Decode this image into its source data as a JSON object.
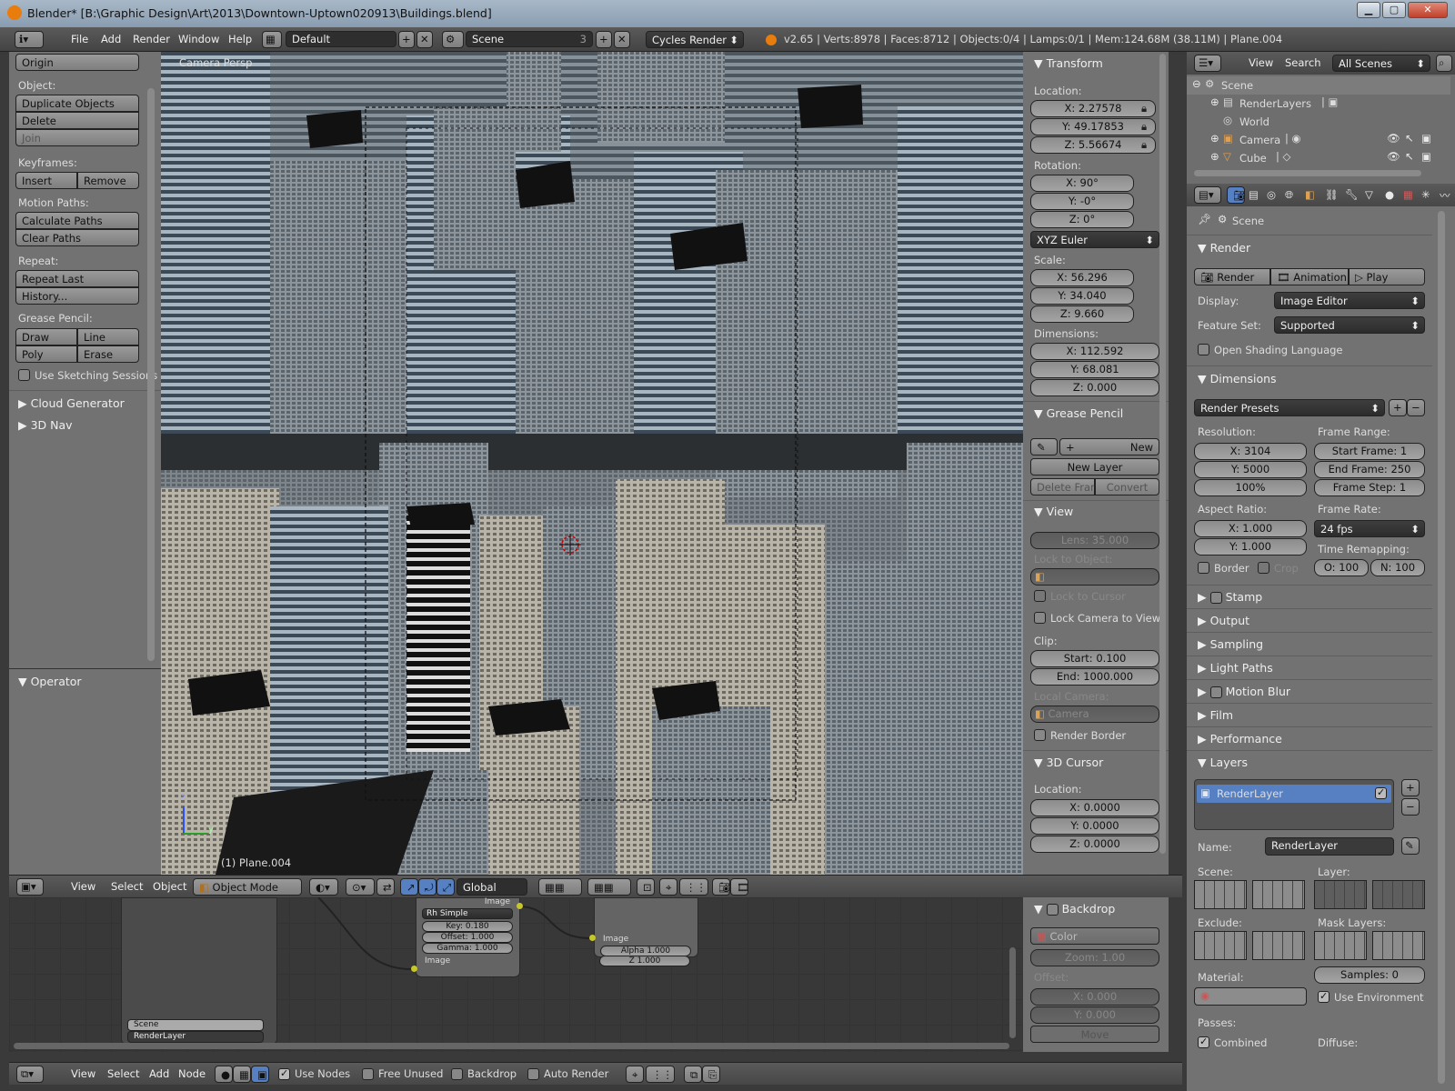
{
  "window": {
    "title": "Blender* [B:\\Graphic Design\\Art\\2013\\Downtown-Uptown020913\\Buildings.blend]",
    "min": "▁",
    "max": "▢",
    "close": "✕"
  },
  "topbar": {
    "menus": [
      "File",
      "Add",
      "Render",
      "Window",
      "Help"
    ],
    "layout": "Default",
    "scene": "Scene",
    "scene_count": "3",
    "engine": "Cycles Render",
    "stats": "v2.65 | Verts:8978 | Faces:8712 | Objects:0/4 | Lamps:0/1 | Mem:124.68M (38.11M) | Plane.004"
  },
  "toolshelf": {
    "origin": "Origin",
    "object_label": "Object:",
    "duplicate": "Duplicate Objects",
    "delete": "Delete",
    "join": "Join",
    "keyframes_label": "Keyframes:",
    "insert": "Insert",
    "remove": "Remove",
    "motion_label": "Motion Paths:",
    "calc_paths": "Calculate Paths",
    "clear_paths": "Clear Paths",
    "repeat_label": "Repeat:",
    "repeat_last": "Repeat Last",
    "history": "History...",
    "grease_label": "Grease Pencil:",
    "draw": "Draw",
    "line": "Line",
    "poly": "Poly",
    "erase": "Erase",
    "sketching": "Use Sketching Sessions",
    "cloud": "Cloud Generator",
    "nav3d": "3D Nav",
    "operator": "Operator"
  },
  "viewport": {
    "label": "Camera Persp",
    "object": "(1) Plane.004",
    "axis_z": "z",
    "axis_y": "y"
  },
  "props_n": {
    "transform": "Transform",
    "location_label": "Location:",
    "loc": [
      "X: 2.27578",
      "Y: 49.17853",
      "Z: 5.56674"
    ],
    "rotation_label": "Rotation:",
    "rot": [
      "X: 90°",
      "Y: -0°",
      "Z: 0°"
    ],
    "rot_mode": "XYZ Euler",
    "scale_label": "Scale:",
    "scale": [
      "X: 56.296",
      "Y: 34.040",
      "Z: 9.660"
    ],
    "dims_label": "Dimensions:",
    "dims": [
      "X: 112.592",
      "Y: 68.081",
      "Z: 0.000"
    ],
    "grease": "Grease Pencil",
    "gp_new": "New",
    "gp_new_layer": "New Layer",
    "gp_delete_frame": "Delete Frame",
    "gp_convert": "Convert",
    "view": "View",
    "lens": "Lens: 35.000",
    "lock_obj_label": "Lock to Object:",
    "lock_cursor": "Lock to Cursor",
    "lock_cam": "Lock Camera to View",
    "clip_label": "Clip:",
    "clip_start": "Start: 0.100",
    "clip_end": "End: 1000.000",
    "local_cam_label": "Local Camera:",
    "local_cam": "Camera",
    "render_border": "Render Border",
    "cursor3d": "3D Cursor",
    "cursor_loc_label": "Location:",
    "cursor_loc": [
      "X: 0.0000",
      "Y: 0.0000",
      "Z: 0.0000"
    ]
  },
  "view3d_header": {
    "menus": [
      "View",
      "Select",
      "Object"
    ],
    "mode": "Object Mode",
    "orientation": "Global"
  },
  "node_editor": {
    "node1": {
      "header": "Image",
      "type": "Rh Simple",
      "key": "Key: 0.180",
      "offset": "Offset: 1.000",
      "gamma": "Gamma: 1.000",
      "out": "Image"
    },
    "node2": {
      "in": "Image",
      "alpha": "Alpha 1.000",
      "z": "Z 1.000"
    },
    "rl_scene": "Scene",
    "rl_layer": "RenderLayer",
    "backdrop": "Backdrop",
    "bd_color": "Color",
    "bd_zoom": "Zoom: 1.00",
    "bd_offset_label": "Offset:",
    "bd_x": "X: 0.000",
    "bd_y": "Y: 0.000",
    "bd_move": "Move"
  },
  "node_header": {
    "menus": [
      "View",
      "Select",
      "Add",
      "Node"
    ],
    "use_nodes": "Use Nodes",
    "free_unused": "Free Unused",
    "backdrop": "Backdrop",
    "auto_render": "Auto Render"
  },
  "outliner": {
    "view": "View",
    "search": "Search",
    "filter": "All Scenes",
    "items": [
      "Scene",
      "RenderLayers",
      "World",
      "Camera",
      "Cube"
    ]
  },
  "properties": {
    "context": "Scene",
    "render_panel": "Render",
    "btn_render": "Render",
    "btn_anim": "Animation",
    "btn_play": "Play",
    "display_label": "Display:",
    "display": "Image Editor",
    "feature_label": "Feature Set:",
    "feature": "Supported",
    "osl": "Open Shading Language",
    "dimensions": "Dimensions",
    "presets": "Render Presets",
    "res_label": "Resolution:",
    "res_x": "X: 3104",
    "res_y": "Y: 5000",
    "res_pct": "100%",
    "frame_range_label": "Frame Range:",
    "start": "Start Frame: 1",
    "end": "End Frame: 250",
    "step": "Frame Step: 1",
    "aspect_label": "Aspect Ratio:",
    "asp_x": "X: 1.000",
    "asp_y": "Y: 1.000",
    "fps_label": "Frame Rate:",
    "fps": "24 fps",
    "remap_label": "Time Remapping:",
    "remap_o": "O: 100",
    "remap_n": "N: 100",
    "border": "Border",
    "crop": "Crop",
    "sections": [
      "Stamp",
      "Output",
      "Sampling",
      "Light Paths",
      "Motion Blur",
      "Film",
      "Performance",
      "Layers"
    ],
    "layer_item": "RenderLayer",
    "name_label": "Name:",
    "name": "RenderLayer",
    "scene_label": "Scene:",
    "layer_label": "Layer:",
    "exclude_label": "Exclude:",
    "mask_label": "Mask Layers:",
    "material_label": "Material:",
    "samples": "Samples: 0",
    "use_env": "Use Environment",
    "passes_label": "Passes:",
    "combined": "Combined",
    "diffuse_label": "Diffuse:"
  }
}
